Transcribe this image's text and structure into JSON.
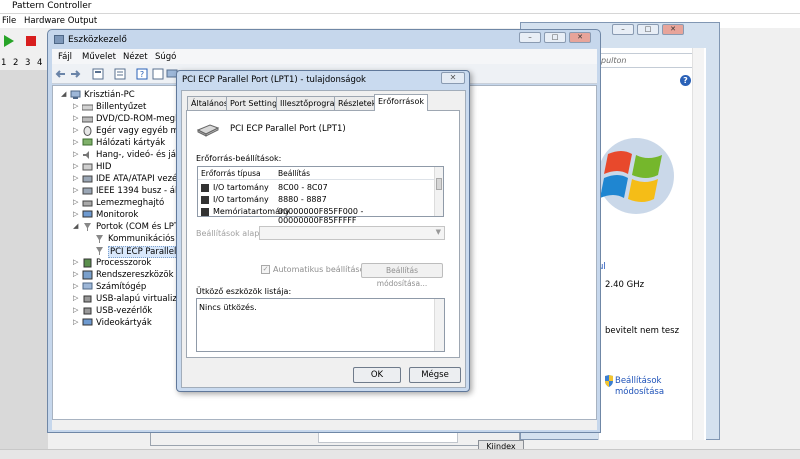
{
  "app": {
    "title": "Pattern Controller",
    "menu": [
      "File",
      "Hardware Output"
    ],
    "channels": [
      "1",
      "2",
      "3",
      "4"
    ]
  },
  "control_panel": {
    "search_placeholder": "pulton",
    "texts": {
      "ghz": "2.40 GHz",
      "input": "bevitelt nem tesz",
      "ul": "ul",
      "settings_link_1": "Beállítások",
      "settings_link_2": "módosítása"
    },
    "bottom_button": "Kiindex"
  },
  "device_manager": {
    "title": "Eszközkezelő",
    "menu": [
      "Fájl",
      "Művelet",
      "Nézet",
      "Súgó"
    ],
    "tree": [
      {
        "label": "Krisztián-PC",
        "arrow": "◢",
        "icon": "computer-icon"
      },
      {
        "label": "Billentyűzet",
        "arrow": "▷",
        "icon": "keyboard-icon"
      },
      {
        "label": "DVD/CD-ROM-meghajtók",
        "arrow": "▷",
        "icon": "dvd-drive-icon"
      },
      {
        "label": "Egér vagy egyéb mutató",
        "arrow": "▷",
        "icon": "mouse-icon"
      },
      {
        "label": "Hálózati kártyák",
        "arrow": "▷",
        "icon": "network-adapter-icon"
      },
      {
        "label": "Hang-, videó- és játékvezérlők",
        "arrow": "▷",
        "icon": "sound-icon"
      },
      {
        "label": "HID",
        "arrow": "▷",
        "icon": "hid-icon"
      },
      {
        "label": "IDE ATA/ATAPI vezérlők",
        "arrow": "▷",
        "icon": "ide-icon"
      },
      {
        "label": "IEEE 1394 busz - állomásvezérlők",
        "arrow": "▷",
        "icon": "ieee1394-icon"
      },
      {
        "label": "Lemezmeghajtó",
        "arrow": "▷",
        "icon": "disk-drive-icon"
      },
      {
        "label": "Monitorok",
        "arrow": "▷",
        "icon": "monitor-icon"
      },
      {
        "label": "Portok (COM és LPT)",
        "arrow": "◢",
        "icon": "port-icon"
      },
      {
        "label": "Kommunikációs port",
        "arrow": "",
        "icon": "port-device-icon"
      },
      {
        "label": "PCI ECP Parallel Port",
        "arrow": "",
        "icon": "port-device-icon"
      },
      {
        "label": "Processzorok",
        "arrow": "▷",
        "icon": "processor-icon"
      },
      {
        "label": "Rendszereszközök",
        "arrow": "▷",
        "icon": "system-devices-icon"
      },
      {
        "label": "Számítógép",
        "arrow": "▷",
        "icon": "computer-icon"
      },
      {
        "label": "USB-alapú virtualizáció",
        "arrow": "▷",
        "icon": "usb-virtual-icon"
      },
      {
        "label": "USB-vezérlők",
        "arrow": "▷",
        "icon": "usb-controller-icon"
      },
      {
        "label": "Videokártyák",
        "arrow": "▷",
        "icon": "display-adapter-icon"
      }
    ]
  },
  "properties_dialog": {
    "title": "PCI ECP Parallel Port (LPT1) - tulajdonságok",
    "close": "✕",
    "tabs": [
      "Általános",
      "Port Settings",
      "Illesztőprogram",
      "Részletek",
      "Erőforrások"
    ],
    "active_tab": "Erőforrások",
    "device_name": "PCI ECP Parallel Port (LPT1)",
    "resource_settings_label": "Erőforrás-beállítások:",
    "resource_columns": [
      "Erőforrás típusa",
      "Beállítás"
    ],
    "resources": [
      {
        "type": "I/O tartomány",
        "setting": "8C00 - 8C07"
      },
      {
        "type": "I/O tartomány",
        "setting": "8880 - 8887"
      },
      {
        "type": "Memóriatartomány",
        "setting": "00000000F85FF000 - 00000000F85FFFFF"
      }
    ],
    "settings_base_label": "Beállítások alapja:",
    "settings_base_value": "",
    "auto_settings_label": "Automatikus beállítások",
    "auto_settings_checked": true,
    "change_settings_button": "Beállítás módosítása...",
    "conflict_label": "Ütköző eszközök listája:",
    "conflict_text": "Nincs ütközés.",
    "ok_button": "OK",
    "cancel_button": "Mégse"
  }
}
